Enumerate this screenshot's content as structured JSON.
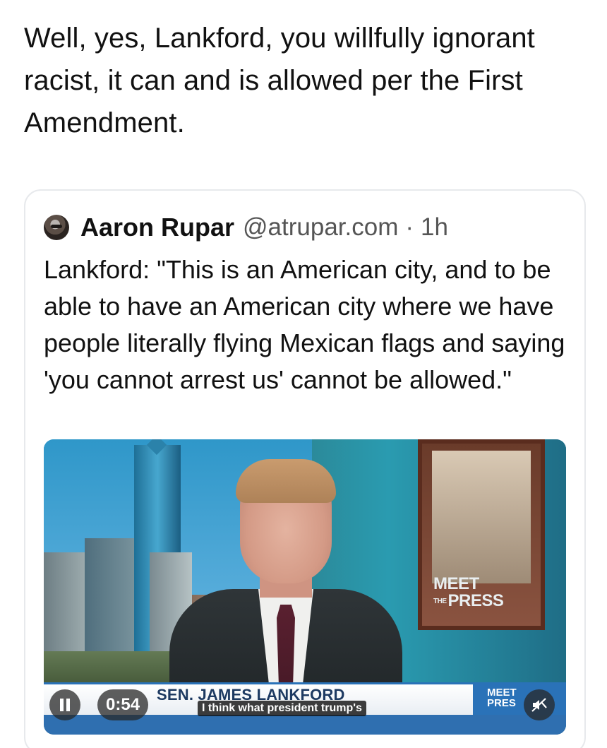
{
  "post": {
    "text": "Well, yes, Lankford, you willfully ignorant racist, it can and is allowed per the First Amendment."
  },
  "quote": {
    "author_name": "Aaron Rupar",
    "handle": "@atrupar.com",
    "separator": "·",
    "time": "1h",
    "body": "Lankford: \"This is an American city, and to be able to have an American city where we have people literally flying Mexican flags and saying 'you cannot arrest us' cannot be allowed.\""
  },
  "video": {
    "lower_third_name": "SEN. JAMES LANKFORD",
    "caption": "I think what president trump's",
    "duration": "0:54",
    "logo_main": "MEET",
    "logo_small": "THE",
    "logo_second": "PRESS",
    "corner_logo_line1": "MEET",
    "corner_logo_line2": "PRES",
    "pause_icon": "pause-icon",
    "mute_icon": "mute-icon"
  }
}
